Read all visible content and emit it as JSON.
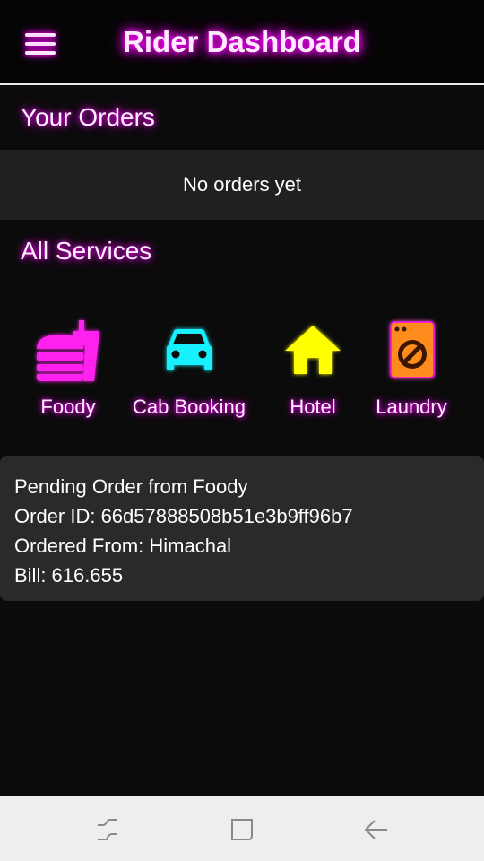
{
  "app_bar": {
    "title": "Rider Dashboard",
    "menu_icon": "hamburger-menu-icon"
  },
  "orders": {
    "heading": "Your Orders",
    "empty_text": "No orders yet"
  },
  "services": {
    "heading": "All Services",
    "items": [
      {
        "label": "Foody",
        "icon": "food-drink-icon",
        "color": "#ff22ee"
      },
      {
        "label": "Cab Booking",
        "icon": "car-icon",
        "color": "#19f0ff"
      },
      {
        "label": "Hotel",
        "icon": "house-icon",
        "color": "#ffff00"
      },
      {
        "label": "Laundry",
        "icon": "washing-machine-icon",
        "color": "#ff8c1a"
      }
    ]
  },
  "pending_order": {
    "lines": [
      "Pending Order from Foody",
      "Order ID: 66d57888508b51e3b9ff96b7",
      "Ordered From: Himachal",
      "Bill: 616.655"
    ]
  },
  "system_nav": {
    "recents_icon": "recents-icon",
    "home_icon": "home-square-icon",
    "back_icon": "back-arrow-icon"
  }
}
